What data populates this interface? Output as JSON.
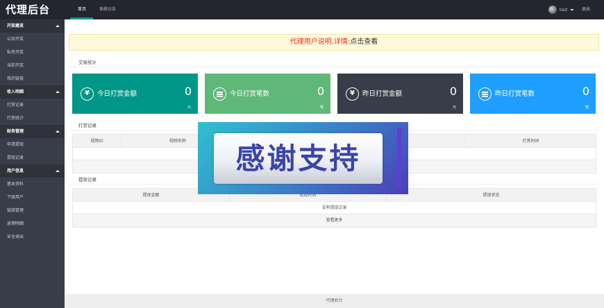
{
  "header": {
    "logo": "代理后台",
    "nav": [
      {
        "label": "首页",
        "active": true
      },
      {
        "label": "系统公告",
        "active": false
      }
    ],
    "user": "test",
    "logout": "退出"
  },
  "sidebar": {
    "groups": [
      {
        "title": "开奖概览",
        "items": [
          "公共开奖",
          "私有开奖",
          "当前开奖",
          "我的链接"
        ]
      },
      {
        "title": "收入明细",
        "items": [
          "打赏记录",
          "打赏统计"
        ]
      },
      {
        "title": "财务管理",
        "items": [
          "申请提现",
          "提现记录"
        ]
      },
      {
        "title": "用户信息",
        "items": [
          "基本资料",
          "下级用户",
          "链接管理",
          "返佣明细"
        ]
      }
    ],
    "standalone": "安全退出"
  },
  "notice": {
    "highlight": "代理用户说明,详情:",
    "rest": "点击查看"
  },
  "stats": {
    "title": "交易统计",
    "cards": [
      {
        "label": "今日打赏金额",
        "value": "0",
        "unit": "元",
        "icon": "yuan-icon",
        "color": "#009688"
      },
      {
        "label": "今日打赏笔数",
        "value": "0",
        "unit": "笔",
        "icon": "list-icon",
        "color": "#5fb878"
      },
      {
        "label": "昨日打赏金额",
        "value": "0",
        "unit": "元",
        "icon": "yuan-icon",
        "color": "#393d49"
      },
      {
        "label": "昨日打赏笔数",
        "value": "0",
        "unit": "笔",
        "icon": "list-icon",
        "color": "#1e9fff"
      }
    ]
  },
  "tip_records": {
    "title": "打赏记录",
    "columns": [
      "视频ID",
      "视频名称",
      "",
      "",
      "打赏时间"
    ]
  },
  "withdraw_records": {
    "title": "提现记录",
    "columns": [
      "提现金额",
      "提现时间",
      "提现状态"
    ],
    "empty": "没有提现记录",
    "more": "查看更多"
  },
  "banner": {
    "text": "感谢支持"
  },
  "footer": {
    "text": "代理后台"
  }
}
